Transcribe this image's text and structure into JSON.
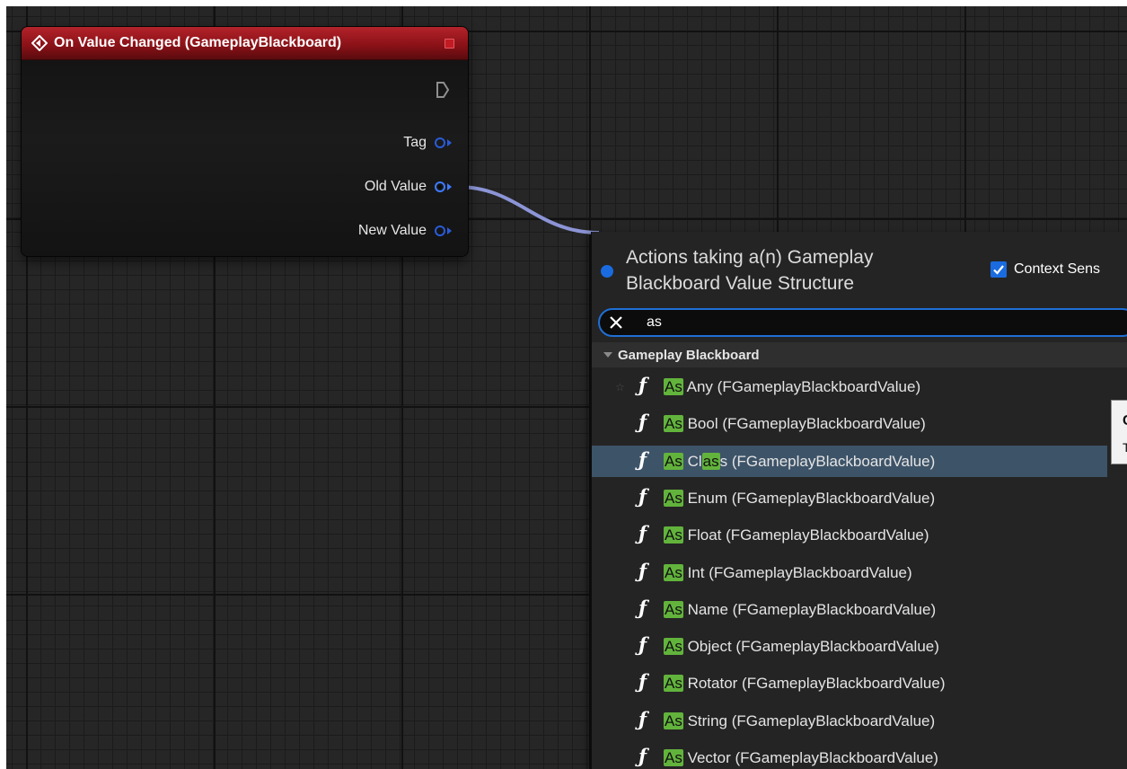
{
  "event_node": {
    "title": "On Value Changed (GameplayBlackboard)",
    "pins": {
      "tag": "Tag",
      "old_value": "Old Value",
      "new_value": "New Value"
    }
  },
  "action_menu": {
    "title": "Actions taking a(n) Gameplay Blackboard Value Structure",
    "context_sensitive": {
      "label": "Context Sens",
      "checked": true
    },
    "search": {
      "value": "as"
    },
    "category": "Gameplay Blackboard",
    "items": [
      {
        "prefix": "As",
        "pre_match": "",
        "match": "",
        "post_match": "Any (FGameplayBlackboardValue)"
      },
      {
        "prefix": "As",
        "pre_match": "",
        "match": "",
        "post_match": "Bool (FGameplayBlackboardValue)"
      },
      {
        "prefix": "As",
        "pre_match": "Cl",
        "match": "as",
        "post_match": "s (FGameplayBlackboardValue)"
      },
      {
        "prefix": "As",
        "pre_match": "",
        "match": "",
        "post_match": "Enum (FGameplayBlackboardValue)"
      },
      {
        "prefix": "As",
        "pre_match": "",
        "match": "",
        "post_match": "Float (FGameplayBlackboardValue)"
      },
      {
        "prefix": "As",
        "pre_match": "",
        "match": "",
        "post_match": "Int (FGameplayBlackboardValue)"
      },
      {
        "prefix": "As",
        "pre_match": "",
        "match": "",
        "post_match": "Name (FGameplayBlackboardValue)"
      },
      {
        "prefix": "As",
        "pre_match": "",
        "match": "",
        "post_match": "Object (FGameplayBlackboardValue)"
      },
      {
        "prefix": "As",
        "pre_match": "",
        "match": "",
        "post_match": "Rotator (FGameplayBlackboardValue)"
      },
      {
        "prefix": "As",
        "pre_match": "",
        "match": "",
        "post_match": "String (FGameplayBlackboardValue)"
      },
      {
        "prefix": "As",
        "pre_match": "",
        "match": "",
        "post_match": "Vector (FGameplayBlackboardValue)"
      }
    ],
    "selected_index": 2,
    "function_glyph": "ƒ",
    "favorite_glyph": "☆"
  },
  "tooltip": {
    "line1": "C",
    "line2": "T"
  },
  "colors": {
    "graph_background": "#262626",
    "event_header": "#8c1218",
    "pin_struct": "#3d7bff",
    "search_highlight": "#62b33c",
    "selection": "#3d5368",
    "accent": "#1a6be0"
  }
}
